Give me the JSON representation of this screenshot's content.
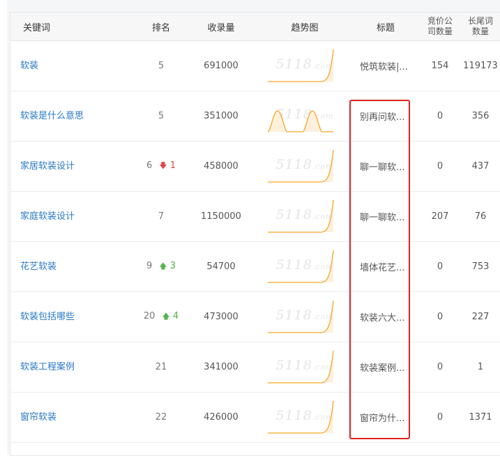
{
  "headers": {
    "keyword": "关键词",
    "rank": "排名",
    "indexed": "收录量",
    "trend": "趋势图",
    "title": "标题",
    "bid_line1": "竞价公",
    "bid_line2": "司数量",
    "longtail_line1": "长尾词",
    "longtail_line2": "数量"
  },
  "watermark": "5118",
  "watermark_suffix": ".com",
  "rows": [
    {
      "keyword": "软装",
      "rank": "5",
      "change_dir": "",
      "change": "",
      "indexed": "691000",
      "title": "悦筑软装|...",
      "bid": "154",
      "longtail": "119173",
      "trend": "rise"
    },
    {
      "keyword": "软装是什么意思",
      "rank": "5",
      "change_dir": "",
      "change": "",
      "indexed": "351000",
      "title": "别再问软...",
      "bid": "0",
      "longtail": "356",
      "trend": "double"
    },
    {
      "keyword": "家居软装设计",
      "rank": "6",
      "change_dir": "down",
      "change": "1",
      "indexed": "458000",
      "title": "聊一聊软...",
      "bid": "0",
      "longtail": "437",
      "trend": "rise"
    },
    {
      "keyword": "家庭软装设计",
      "rank": "7",
      "change_dir": "",
      "change": "",
      "indexed": "1150000",
      "title": "聊一聊软...",
      "bid": "207",
      "longtail": "76",
      "trend": "rise"
    },
    {
      "keyword": "花艺软装",
      "rank": "9",
      "change_dir": "up",
      "change": "3",
      "indexed": "54700",
      "title": "墙体花艺...",
      "bid": "0",
      "longtail": "753",
      "trend": "rise"
    },
    {
      "keyword": "软装包括哪些",
      "rank": "20",
      "change_dir": "up",
      "change": "4",
      "indexed": "473000",
      "title": "软装六大...",
      "bid": "0",
      "longtail": "227",
      "trend": "rise"
    },
    {
      "keyword": "软装工程案例",
      "rank": "21",
      "change_dir": "",
      "change": "",
      "indexed": "341000",
      "title": "软装案例...",
      "bid": "0",
      "longtail": "1",
      "trend": "rise"
    },
    {
      "keyword": "窗帘软装",
      "rank": "22",
      "change_dir": "",
      "change": "",
      "indexed": "426000",
      "title": "窗帘为什...",
      "bid": "0",
      "longtail": "1371",
      "trend": "rise"
    }
  ],
  "colors": {
    "link": "#2878c6",
    "down": "#e04646",
    "up": "#52b34c",
    "trend_line": "#f5a623",
    "highlight_box": "#e02020"
  }
}
